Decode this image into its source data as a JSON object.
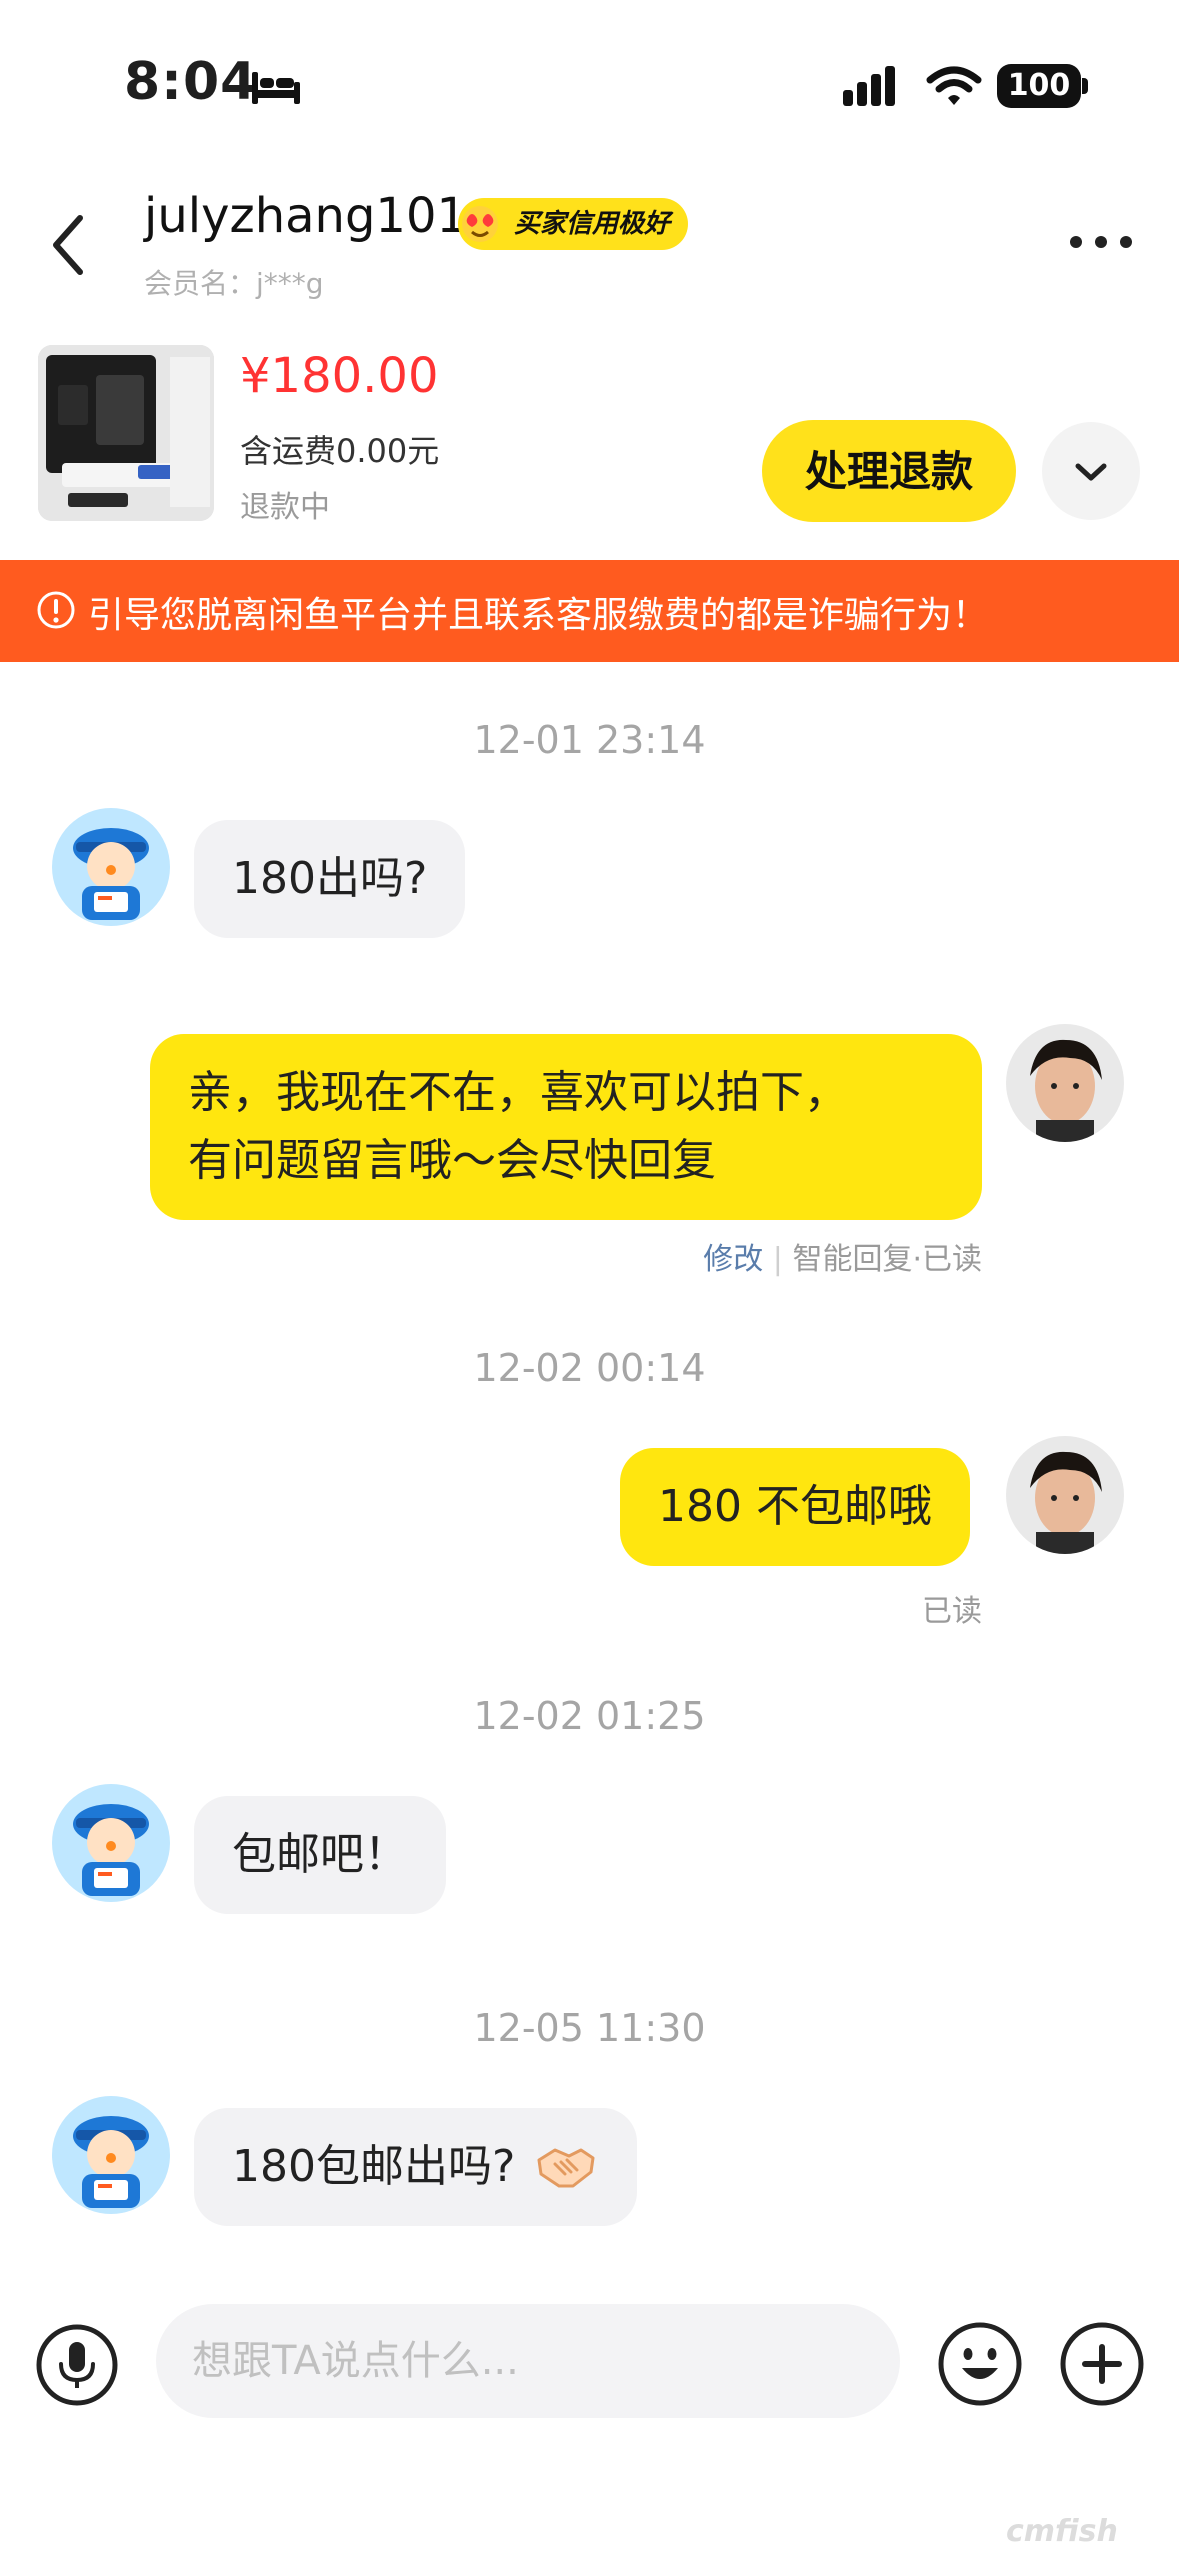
{
  "status_bar": {
    "time": "8:04",
    "battery": "100"
  },
  "header": {
    "username": "julyzhang101",
    "credit_badge": "买家信用极好",
    "member_name": "会员名：j***g"
  },
  "product": {
    "price": "¥180.00",
    "shipping": "含运费0.00元",
    "status": "退款中",
    "action_button": "处理退款"
  },
  "warning_banner": "引导您脱离闲鱼平台并且联系客服缴费的都是诈骗行为！",
  "messages": [
    {
      "timestamp": "12-01 23:14"
    },
    {
      "from": "buyer",
      "text": "180出吗?"
    },
    {
      "from": "seller",
      "lines": [
        "亲，我现在不在，喜欢可以拍下，",
        "有问题留言哦～会尽快回复"
      ],
      "edit_link": "修改",
      "meta": "智能回复·已读"
    },
    {
      "timestamp": "12-02 00:14"
    },
    {
      "from": "seller",
      "text": "180 不包邮哦",
      "meta": "已读"
    },
    {
      "timestamp": "12-02 01:25"
    },
    {
      "from": "buyer",
      "text": "包邮吧！"
    },
    {
      "timestamp": "12-05 11:30"
    },
    {
      "from": "buyer",
      "text": "180包邮出吗?"
    }
  ],
  "input_bar": {
    "placeholder": "想跟TA说点什么..."
  },
  "watermark": "cmfish",
  "icons": {
    "back": "chevron-left-icon",
    "more": "more-horizontal-icon",
    "expand": "chevron-down-icon",
    "mic": "microphone-icon",
    "emoji": "smiley-icon",
    "plus": "plus-icon",
    "handshake": "handshake-emoji"
  },
  "colors": {
    "accent_yellow": "#ffe11b",
    "warning_orange": "#ff5b1f",
    "price_red": "#ff3333"
  }
}
